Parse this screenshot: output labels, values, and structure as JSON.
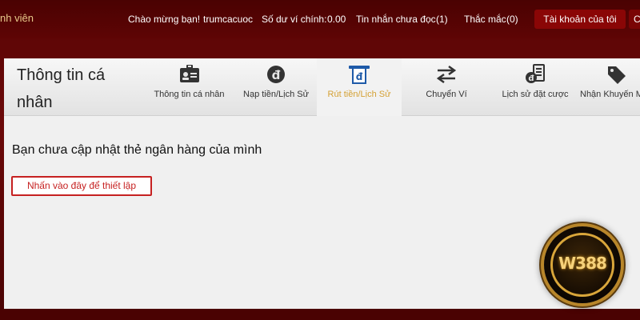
{
  "topbar": {
    "member_label": "nh viên",
    "welcome": "Chào mừng bạn!",
    "username": "trumcacuoc",
    "balance_label": "Số dư ví chính:",
    "balance_value": "0.00",
    "unread_label": "Tin nhắn chưa đọc",
    "unread_count": "(1)",
    "faq_label": "Thắc mắc",
    "faq_count": "(0)",
    "account_button": "Tài khoản của tôi",
    "second_button": "C"
  },
  "panel": {
    "title": "Thông tin cá nhân",
    "tabs": [
      {
        "label": "Thông tin cá nhân",
        "icon": "id-card-icon"
      },
      {
        "label": "Nạp tiền/Lịch Sử",
        "icon": "dong-coin-icon"
      },
      {
        "label": "Rút tiền/Lịch Sử",
        "icon": "atm-withdraw-icon"
      },
      {
        "label": "Chuyển Ví",
        "icon": "transfer-arrows-icon"
      },
      {
        "label": "Lịch sử đặt cược",
        "icon": "bet-history-icon"
      },
      {
        "label": "Nhận Khuyến M",
        "icon": "tag-icon"
      }
    ],
    "active_tab": 2,
    "notice": "Bạn chưa cập nhật thẻ ngân hàng của mình",
    "setup_button": "Nhấn vào đây để thiết lập"
  },
  "logo": {
    "text": "W388"
  },
  "colors": {
    "background": "#5a0505",
    "active_tab_text": "#d4a134",
    "setup_button_border": "#c62121",
    "account_button_bg": "#8a0606"
  }
}
